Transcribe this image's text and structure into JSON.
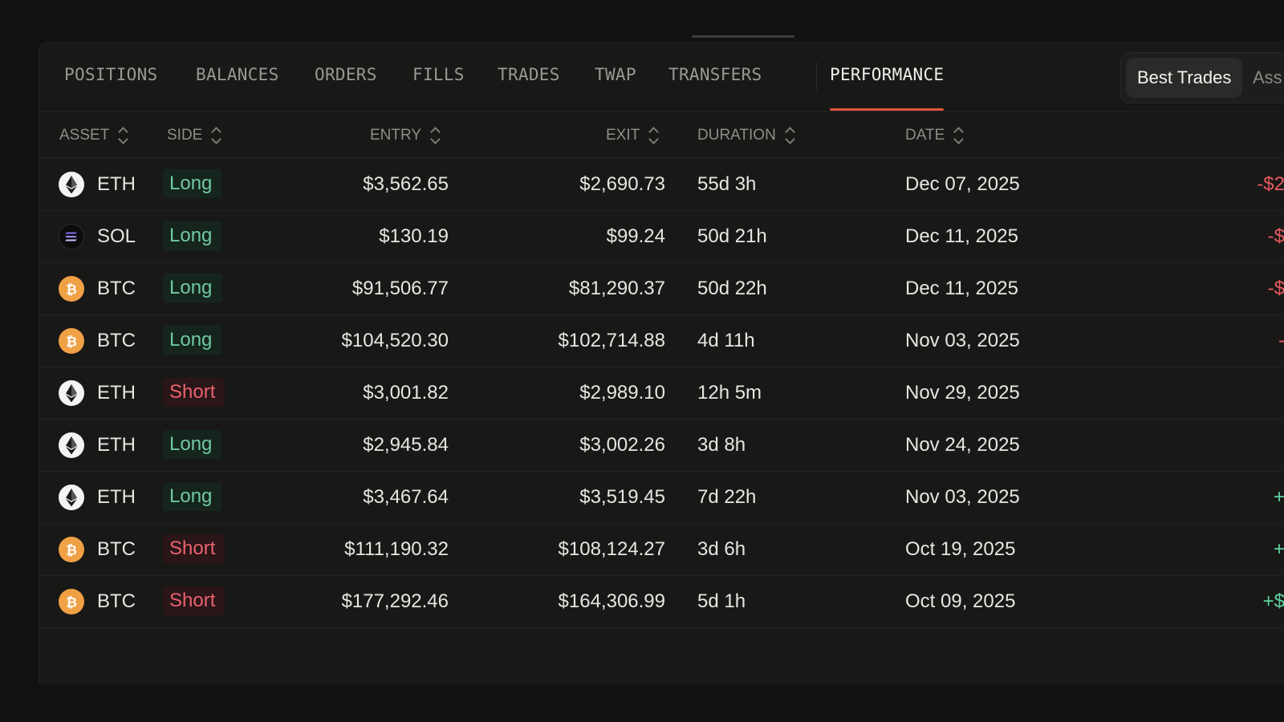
{
  "tabs": [
    {
      "label": "POSITIONS"
    },
    {
      "label": "BALANCES"
    },
    {
      "label": "ORDERS"
    },
    {
      "label": "FILLS"
    },
    {
      "label": "TRADES"
    },
    {
      "label": "TWAP"
    },
    {
      "label": "TRANSFERS"
    },
    {
      "label": "PERFORMANCE",
      "active": true
    }
  ],
  "toggle": {
    "selected": "Best Trades",
    "other": "Ass"
  },
  "columns": {
    "asset": "ASSET",
    "side": "SIDE",
    "entry": "ENTRY",
    "exit": "EXIT",
    "duration": "DURATION",
    "date": "DATE"
  },
  "colors": {
    "accent": "#e0553a",
    "long": "#6fc9a2",
    "short": "#e8636e",
    "btc": "#f0a045"
  },
  "rows": [
    {
      "icon": "eth-icon",
      "asset": "ETH",
      "side": "Long",
      "entry": "$3,562.65",
      "exit": "$2,690.73",
      "duration": "55d 3h",
      "date": "Dec 07, 2025",
      "pnl": "-$2"
    },
    {
      "icon": "sol-icon",
      "asset": "SOL",
      "side": "Long",
      "entry": "$130.19",
      "exit": "$99.24",
      "duration": "50d 21h",
      "date": "Dec 11, 2025",
      "pnl": "-$"
    },
    {
      "icon": "btc-icon",
      "asset": "BTC",
      "side": "Long",
      "entry": "$91,506.77",
      "exit": "$81,290.37",
      "duration": "50d 22h",
      "date": "Dec 11, 2025",
      "pnl": "-$"
    },
    {
      "icon": "btc-icon",
      "asset": "BTC",
      "side": "Long",
      "entry": "$104,520.30",
      "exit": "$102,714.88",
      "duration": "4d 11h",
      "date": "Nov 03, 2025",
      "pnl": "-"
    },
    {
      "icon": "eth-icon",
      "asset": "ETH",
      "side": "Short",
      "entry": "$3,001.82",
      "exit": "$2,989.10",
      "duration": "12h 5m",
      "date": "Nov 29, 2025",
      "pnl": ""
    },
    {
      "icon": "eth-icon",
      "asset": "ETH",
      "side": "Long",
      "entry": "$2,945.84",
      "exit": "$3,002.26",
      "duration": "3d 8h",
      "date": "Nov 24, 2025",
      "pnl": ""
    },
    {
      "icon": "eth-icon",
      "asset": "ETH",
      "side": "Long",
      "entry": "$3,467.64",
      "exit": "$3,519.45",
      "duration": "7d 22h",
      "date": "Nov 03, 2025",
      "pnl": "+"
    },
    {
      "icon": "btc-icon",
      "asset": "BTC",
      "side": "Short",
      "entry": "$111,190.32",
      "exit": "$108,124.27",
      "duration": "3d 6h",
      "date": "Oct 19, 2025",
      "pnl": "+"
    },
    {
      "icon": "btc-icon",
      "asset": "BTC",
      "side": "Short",
      "entry": "$177,292.46",
      "exit": "$164,306.99",
      "duration": "5d 1h",
      "date": "Oct 09, 2025",
      "pnl": "+$"
    }
  ]
}
